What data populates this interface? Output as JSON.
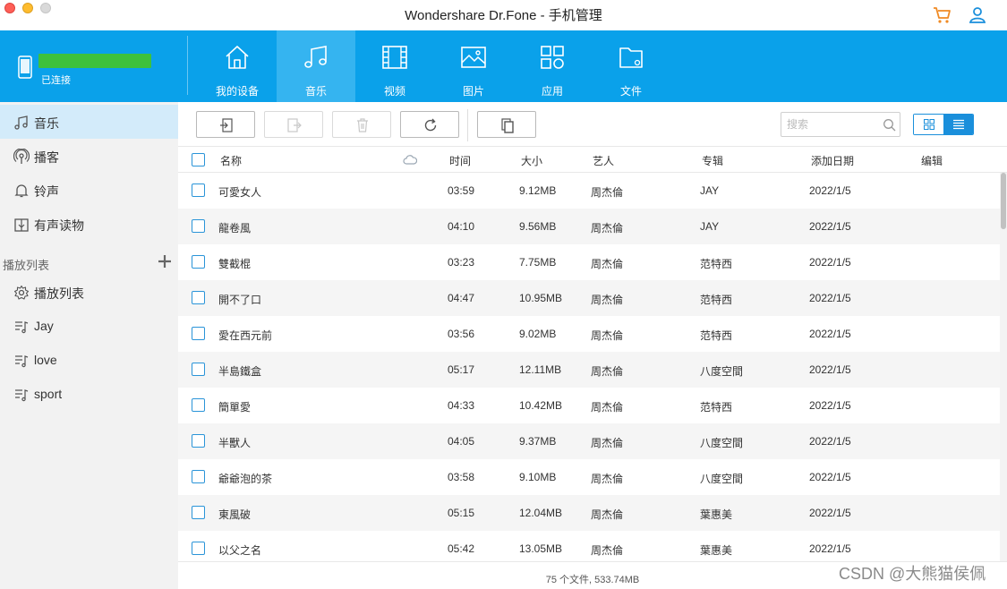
{
  "window": {
    "title": "Wondershare Dr.Fone - 手机管理"
  },
  "device": {
    "status": "已连接",
    "bar_color": "#3ec13c"
  },
  "colors": {
    "header_blue": "#0aa1ea",
    "active_tab": "#35b4f0",
    "accent": "#1a8fdb",
    "cart_orange": "#f08a24"
  },
  "nav": {
    "items": [
      {
        "label": "我的设备",
        "icon": "home-icon"
      },
      {
        "label": "音乐",
        "icon": "music-icon",
        "active": true
      },
      {
        "label": "视频",
        "icon": "film-icon"
      },
      {
        "label": "图片",
        "icon": "image-icon"
      },
      {
        "label": "应用",
        "icon": "apps-icon"
      },
      {
        "label": "文件",
        "icon": "folder-icon"
      }
    ]
  },
  "sidebar": {
    "items": [
      {
        "label": "音乐",
        "icon": "music-note-icon",
        "active": true
      },
      {
        "label": "播客",
        "icon": "podcast-icon"
      },
      {
        "label": "铃声",
        "icon": "bell-icon"
      },
      {
        "label": "有声读物",
        "icon": "audiobook-icon"
      }
    ],
    "playlist_section": "播放列表",
    "playlists": [
      {
        "label": "播放列表",
        "icon": "gear-icon"
      },
      {
        "label": "Jay",
        "icon": "playlist-icon"
      },
      {
        "label": "love",
        "icon": "playlist-icon"
      },
      {
        "label": "sport",
        "icon": "playlist-icon"
      }
    ]
  },
  "toolbar": {
    "search_placeholder": "搜索"
  },
  "table": {
    "columns": [
      "名称",
      "时间",
      "大小",
      "艺人",
      "专辑",
      "添加日期",
      "编辑"
    ],
    "rows": [
      {
        "name": "可愛女人",
        "time": "03:59",
        "size": "9.12MB",
        "artist": "周杰倫",
        "album": "JAY",
        "date": "2022/1/5"
      },
      {
        "name": "龍卷風",
        "time": "04:10",
        "size": "9.56MB",
        "artist": "周杰倫",
        "album": "JAY",
        "date": "2022/1/5"
      },
      {
        "name": "雙截棍",
        "time": "03:23",
        "size": "7.75MB",
        "artist": "周杰倫",
        "album": "范特西",
        "date": "2022/1/5"
      },
      {
        "name": "開不了口",
        "time": "04:47",
        "size": "10.95MB",
        "artist": "周杰倫",
        "album": "范特西",
        "date": "2022/1/5"
      },
      {
        "name": "愛在西元前",
        "time": "03:56",
        "size": "9.02MB",
        "artist": "周杰倫",
        "album": "范特西",
        "date": "2022/1/5"
      },
      {
        "name": "半島鐵盒",
        "time": "05:17",
        "size": "12.11MB",
        "artist": "周杰倫",
        "album": "八度空間",
        "date": "2022/1/5"
      },
      {
        "name": "簡單愛",
        "time": "04:33",
        "size": "10.42MB",
        "artist": "周杰倫",
        "album": "范特西",
        "date": "2022/1/5"
      },
      {
        "name": "半獸人",
        "time": "04:05",
        "size": "9.37MB",
        "artist": "周杰倫",
        "album": "八度空間",
        "date": "2022/1/5"
      },
      {
        "name": "爺爺泡的茶",
        "time": "03:58",
        "size": "9.10MB",
        "artist": "周杰倫",
        "album": "八度空間",
        "date": "2022/1/5"
      },
      {
        "name": "東風破",
        "time": "05:15",
        "size": "12.04MB",
        "artist": "周杰倫",
        "album": "葉惠美",
        "date": "2022/1/5"
      },
      {
        "name": "以父之名",
        "time": "05:42",
        "size": "13.05MB",
        "artist": "周杰倫",
        "album": "葉惠美",
        "date": "2022/1/5"
      }
    ]
  },
  "footer": {
    "summary": "75 个文件, 533.74MB",
    "watermark": "CSDN @大熊猫侯佩"
  }
}
